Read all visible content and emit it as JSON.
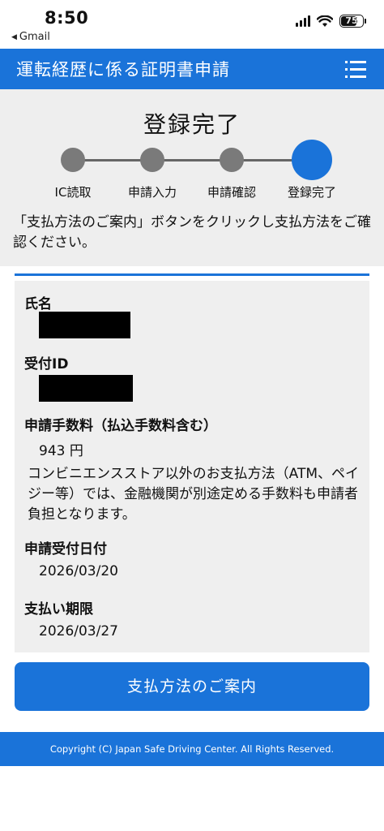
{
  "status_bar": {
    "time": "8:50",
    "back_app": "Gmail",
    "battery": "75",
    "battery_level": 0.75
  },
  "header": {
    "title": "運転経歴に係る証明書申請"
  },
  "progress": {
    "title": "登録完了",
    "steps": [
      "IC読取",
      "申請入力",
      "申請確認",
      "登録完了"
    ],
    "active_index": 3
  },
  "message": "「支払方法のご案内」ボタンをクリックし支払方法をご確認ください。",
  "info": {
    "name_label": "氏名",
    "receipt_id_label": "受付ID",
    "fee_label": "申請手数料（払込手数料含む）",
    "fee_value": "943 円",
    "fee_note": "コンビニエンスストア以外のお支払方法（ATM、ペイジー等）では、金融機関が別途定める手数料も申請者負担となります。",
    "date_label": "申請受付日付",
    "date_value": "2026/03/20",
    "deadline_label": "支払い期限",
    "deadline_value": "2026/03/27"
  },
  "cta_label": "支払方法のご案内",
  "footer": "Copyright (C) Japan Safe Driving Center. All Rights Reserved.",
  "colors": {
    "accent": "#1a73d9",
    "panel": "#efefef",
    "inactive_step": "#7a7a7a"
  }
}
